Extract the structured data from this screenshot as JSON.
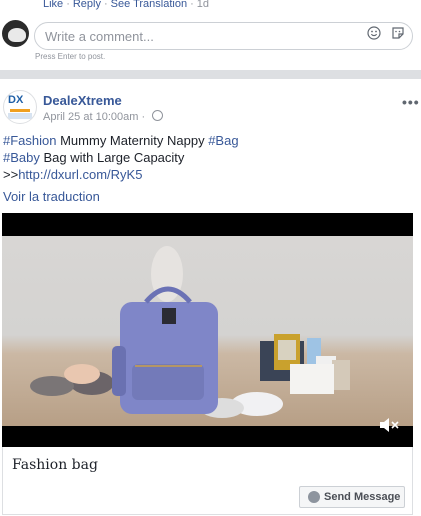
{
  "comment_meta": {
    "like": "Like",
    "reply": "Reply",
    "see_translation": "See Translation",
    "time": "1d",
    "sep": "·"
  },
  "comment_box": {
    "placeholder": "Write a comment...",
    "hint": "Press Enter to post.",
    "icons": [
      "emoji-icon",
      "sticker-icon"
    ]
  },
  "post": {
    "page_name": "DealeXtreme",
    "time": "April 25 at 10:00am",
    "dot": "·",
    "more": "•••",
    "hashtag_fashion": "#Fashion",
    "text_1": " Mummy Maternity Nappy ",
    "hashtag_bag": "#Bag",
    "hashtag_baby": "#Baby",
    "text_2": " Bag with Large Capacity",
    "prefix": ">>",
    "link": "http://dxurl.com/RyK5",
    "translate": "Voir la traduction",
    "avatar_text": "DX"
  },
  "card": {
    "title": "Fashion bag",
    "send_message": "Send Message"
  },
  "colors": {
    "link": "#385898",
    "divider": "#dddfe2",
    "bag": "#7f86c8"
  }
}
